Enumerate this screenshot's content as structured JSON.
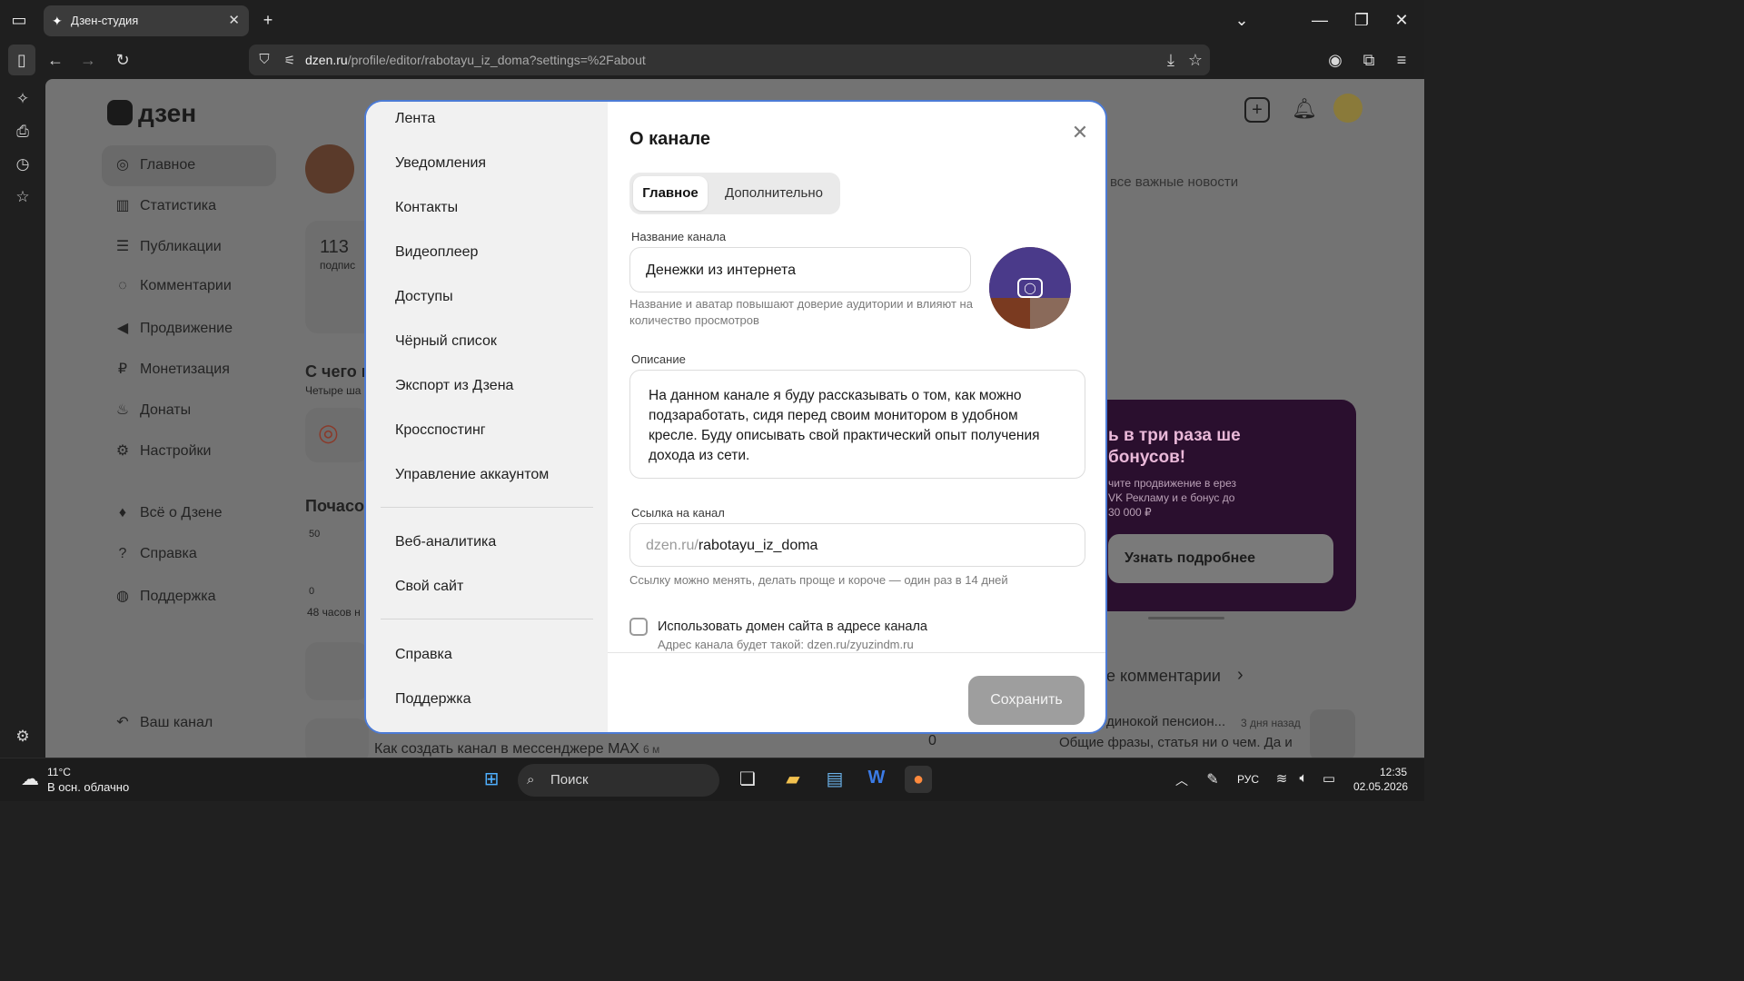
{
  "browser": {
    "tab_title": "Дзен-студия",
    "url_domain": "dzen.ru",
    "url_path": "/profile/editor/rabotayu_iz_doma?settings=%2Fabout"
  },
  "background": {
    "logo": "дзен",
    "nav": [
      {
        "label": "Главное",
        "icon": "compass-icon",
        "active": true
      },
      {
        "label": "Статистика",
        "icon": "bar-chart-icon"
      },
      {
        "label": "Публикации",
        "icon": "stack-icon"
      },
      {
        "label": "Комментарии",
        "icon": "comment-icon"
      },
      {
        "label": "Продвижение",
        "icon": "megaphone-icon"
      },
      {
        "label": "Монетизация",
        "icon": "ruble-icon"
      },
      {
        "label": "Донаты",
        "icon": "donate-icon"
      },
      {
        "label": "Настройки",
        "icon": "gear-icon"
      },
      {
        "label": "Всё о Дзене",
        "icon": "flame-icon"
      },
      {
        "label": "Справка",
        "icon": "help-icon"
      },
      {
        "label": "Поддержка",
        "icon": "support-icon"
      }
    ],
    "your_channel": "Ваш канал",
    "stat_number": "113",
    "stat_label": "подпис",
    "section_start": "С чего н",
    "section_start_sub": "Четыре ша",
    "section_hourly": "Почасо",
    "chart_tick_50": "50",
    "chart_tick_0": "0",
    "chart_footer": "48 часов н",
    "right_news": "все важные новости",
    "promo_title": "ь в три раза ше бонусов!",
    "promo_text": "чите продвижение в ерез VK Рекламу и е бонус до 30 000 ₽",
    "promo_button": "Узнать подробнее",
    "comments_heading": "е комментарии",
    "comment_title": "динокой пенсион...",
    "comment_time": "3 дня назад",
    "comment_text": "Общие фразы, статья ни о чем. Да и",
    "pub_row": "Как создать канал в мессенджере MAX",
    "pub_row_time": "6 м",
    "pub_row_value": "0"
  },
  "modal": {
    "side_group1": [
      "Лента",
      "Уведомления",
      "Контакты",
      "Видеоплеер",
      "Доступы",
      "Чёрный список",
      "Экспорт из Дзена",
      "Кросспостинг",
      "Управление аккаунтом"
    ],
    "side_group2": [
      "Веб-аналитика",
      "Свой сайт"
    ],
    "side_group3": [
      "Справка",
      "Поддержка"
    ],
    "title": "О канале",
    "tabs": [
      "Главное",
      "Дополнительно"
    ],
    "name_label": "Название канала",
    "name_value": "Денежки из интернета",
    "name_hint": "Название и аватар повышают доверие аудитории и влияют на количество просмотров",
    "desc_label": "Описание",
    "desc_value": "На данном канале я буду рассказывать о том, как можно подзаработать, сидя перед своим монитором в удобном кресле. Буду описывать свой практический опыт получения дохода из сети.",
    "link_label": "Ссылка на канал",
    "link_prefix": "dzen.ru/",
    "link_value": "rabotayu_iz_doma",
    "link_hint": "Ссылку можно менять, делать проще и короче — один раз в 14 дней",
    "domain_checkbox": "Использовать домен сайта в адресе канала",
    "domain_hint": "Адрес канала будет такой: dzen.ru/zyuzindm.ru",
    "save_button": "Сохранить"
  },
  "taskbar": {
    "weather_temp": "11°C",
    "weather_desc": "В осн. облачно",
    "search_placeholder": "Поиск",
    "lang": "РУС",
    "time": "12:35",
    "date": "02.05.2026"
  }
}
